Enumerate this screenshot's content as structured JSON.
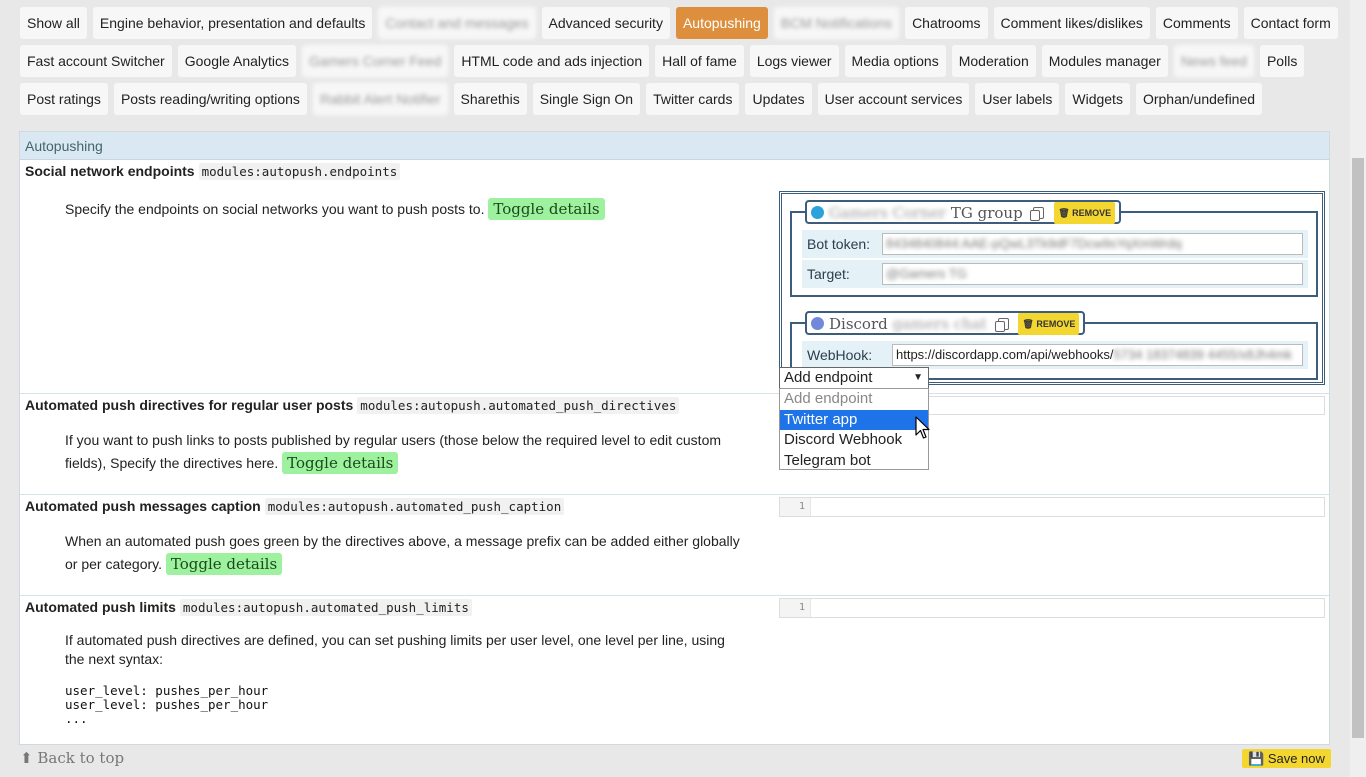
{
  "tabs": {
    "rows": [
      [
        {
          "label": "Show all"
        },
        {
          "label": "Engine behavior, presentation and defaults"
        },
        {
          "label": "Contact and messages",
          "blurred": true
        },
        {
          "label": "Advanced security"
        },
        {
          "label": "Autopushing",
          "active": true
        },
        {
          "label": "BCM Notifications",
          "blurred": true
        },
        {
          "label": "Chatrooms"
        },
        {
          "label": "Comment likes/dislikes"
        },
        {
          "label": "Comments"
        },
        {
          "label": "Contact form"
        }
      ],
      [
        {
          "label": "Fast account Switcher"
        },
        {
          "label": "Google Analytics"
        },
        {
          "label": "Gamers Corner Feed",
          "blurred": true
        },
        {
          "label": "HTML code and ads injection"
        },
        {
          "label": "Hall of fame"
        },
        {
          "label": "Logs viewer"
        },
        {
          "label": "Media options"
        },
        {
          "label": "Moderation"
        },
        {
          "label": "Modules manager"
        },
        {
          "label": "News feed",
          "blurred": true
        },
        {
          "label": "Polls"
        }
      ],
      [
        {
          "label": "Post ratings"
        },
        {
          "label": "Posts reading/writing options"
        },
        {
          "label": "Rabbit Alert Notifier",
          "blurred": true
        },
        {
          "label": "Sharethis"
        },
        {
          "label": "Single Sign On"
        },
        {
          "label": "Twitter cards"
        },
        {
          "label": "Updates"
        },
        {
          "label": "User account services"
        },
        {
          "label": "User labels"
        },
        {
          "label": "Widgets"
        },
        {
          "label": "Orphan/undefined"
        }
      ]
    ]
  },
  "panel": {
    "title": "Autopushing"
  },
  "sections": {
    "endpoints": {
      "title": "Social network endpoints",
      "key": "modules:autopush.endpoints",
      "description": "Specify the endpoints on social networks you want to push posts to.",
      "toggle": "Toggle details"
    },
    "directives": {
      "title": "Automated push directives for regular user posts",
      "key": "modules:autopush.automated_push_directives",
      "description": "If you want to push links to posts published by regular users (those below the required level to edit custom fields), Specify the directives here.",
      "toggle": "Toggle details"
    },
    "caption": {
      "title": "Automated push messages caption",
      "key": "modules:autopush.automated_push_caption",
      "description": "When an automated push goes green by the directives above, a message prefix can be added either globally or per category.",
      "toggle": "Toggle details",
      "editor_line": "1"
    },
    "limits": {
      "title": "Automated push limits",
      "key": "modules:autopush.automated_push_limits",
      "description": "If automated push directives are defined, you can set pushing limits per user level, one level per line, using the next syntax:",
      "code": "user_level: pushes_per_hour\nuser_level: pushes_per_hour\n...",
      "editor_line": "1"
    }
  },
  "endpoints": {
    "telegram": {
      "name": "Gamers Corner",
      "title_suffix": "TG group",
      "remove_label": "REMOVE",
      "bot_token_label": "Bot token:",
      "bot_token_value": "8434840844:AAE-pQwL3Tk9dF7Dcw9sYqXmWrdq",
      "target_label": "Target:",
      "target_value": "@Gamers TG",
      "icon_color": "#2aa3dc"
    },
    "discord": {
      "service": "Discord",
      "name": "gamers chat",
      "remove_label": "REMOVE",
      "webhook_label": "WebHook:",
      "webhook_prefix": "https://discordapp.com/api/webhooks/",
      "webhook_hidden": "5734 18374839 4455",
      "webhook_suffix": "/x8Jh4mk",
      "icon_color": "#7289da"
    }
  },
  "add_endpoint": {
    "selected": "Add endpoint",
    "options": [
      {
        "label": "Add endpoint",
        "placeholder": true
      },
      {
        "label": "Twitter app",
        "highlighted": true
      },
      {
        "label": "Discord Webhook"
      },
      {
        "label": "Telegram bot"
      }
    ]
  },
  "footer": {
    "back_to_top": "Back to top",
    "save_now": "Save now"
  },
  "colors": {
    "active_tab": "#dd8f3e",
    "toggle_bg": "#9ef19e",
    "save_bg": "#f3d630",
    "highlight": "#1e73e8"
  }
}
